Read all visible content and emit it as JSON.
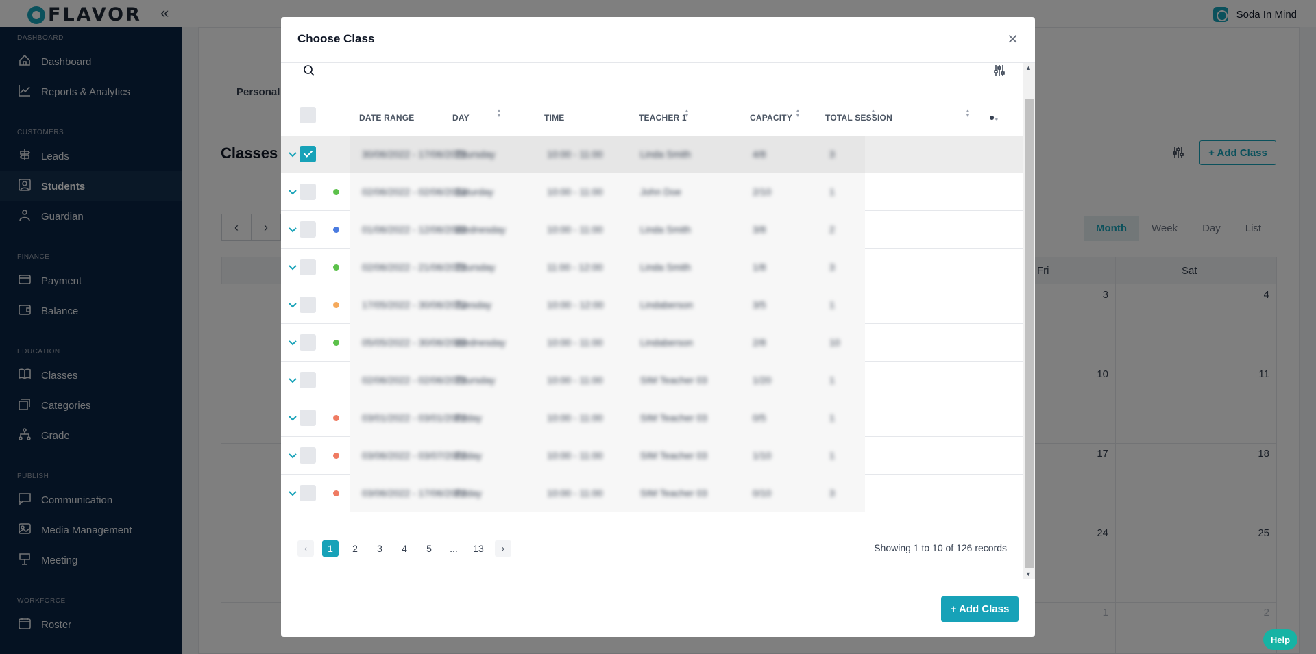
{
  "app": {
    "logo_text": "FLAVOR",
    "org_name": "Soda In Mind"
  },
  "sidebar": {
    "sections": [
      {
        "label": "DASHBOARD",
        "items": [
          {
            "label": "Dashboard",
            "icon": "home-icon"
          },
          {
            "label": "Reports & Analytics",
            "icon": "chart-line-icon"
          }
        ]
      },
      {
        "label": "CUSTOMERS",
        "items": [
          {
            "label": "Leads",
            "icon": "signpost-icon"
          },
          {
            "label": "Students",
            "icon": "student-icon"
          },
          {
            "label": "Guardian",
            "icon": "guardian-icon"
          }
        ]
      },
      {
        "label": "FINANCE",
        "items": [
          {
            "label": "Payment",
            "icon": "card-icon"
          },
          {
            "label": "Balance",
            "icon": "wallet-icon"
          }
        ]
      },
      {
        "label": "EDUCATION",
        "items": [
          {
            "label": "Classes",
            "icon": "book-icon"
          },
          {
            "label": "Categories",
            "icon": "layers-icon"
          },
          {
            "label": "Grade",
            "icon": "hierarchy-icon"
          }
        ]
      },
      {
        "label": "PUBLISH",
        "items": [
          {
            "label": "Communication",
            "icon": "chat-icon"
          },
          {
            "label": "Media Management",
            "icon": "image-icon"
          },
          {
            "label": "Meeting",
            "icon": "podium-icon"
          }
        ]
      },
      {
        "label": "WORKFORCE",
        "items": [
          {
            "label": "Roster",
            "icon": "calendar-icon"
          }
        ]
      }
    ],
    "active": "Students"
  },
  "background": {
    "tab": "Personal",
    "title": "Classes",
    "add_button": "+ Add Class",
    "views": [
      "Month",
      "Week",
      "Day",
      "List"
    ],
    "active_view": "Month",
    "day_headers": [
      "Fri",
      "Sat"
    ],
    "day_numbers": [
      [
        "3",
        "4"
      ],
      [
        "10",
        "11"
      ],
      [
        "17",
        "18"
      ],
      [
        "24",
        "25"
      ],
      [
        "1",
        "2"
      ]
    ]
  },
  "modal": {
    "title": "Choose Class",
    "columns": [
      {
        "label": "DATE RANGE",
        "sortable": true
      },
      {
        "label": "DAY",
        "sortable": false
      },
      {
        "label": "TIME",
        "sortable": true
      },
      {
        "label": "TEACHER 1",
        "sortable": true
      },
      {
        "label": "CAPACITY",
        "sortable": true
      },
      {
        "label": "TOTAL SESSION",
        "sortable": true
      }
    ],
    "rows": [
      {
        "selected": true,
        "dot": "",
        "date_range": "30/06/2022 - 17/06/2022",
        "day": "Thursday",
        "time": "10:00 - 11:00",
        "teacher": "Linda Smith",
        "capacity": "4/8",
        "sessions": "3"
      },
      {
        "selected": false,
        "dot": "#5cc14a",
        "date_range": "02/06/2022 - 02/06/2022",
        "day": "Saturday",
        "time": "10:00 - 11:00",
        "teacher": "John Doe",
        "capacity": "2/10",
        "sessions": "1"
      },
      {
        "selected": false,
        "dot": "#4a7be0",
        "date_range": "01/06/2022 - 12/06/2022",
        "day": "Wednesday",
        "time": "10:00 - 11:00",
        "teacher": "Linda Smith",
        "capacity": "3/8",
        "sessions": "2"
      },
      {
        "selected": false,
        "dot": "#5cc14a",
        "date_range": "02/06/2022 - 21/06/2022",
        "day": "Thursday",
        "time": "11:00 - 12:00",
        "teacher": "Linda Smith",
        "capacity": "1/8",
        "sessions": "3"
      },
      {
        "selected": false,
        "dot": "#f5a95b",
        "date_range": "17/05/2022 - 30/06/2022",
        "day": "Tuesday",
        "time": "10:00 - 12:00",
        "teacher": "Lindaberson",
        "capacity": "3/5",
        "sessions": "1"
      },
      {
        "selected": false,
        "dot": "#5cc14a",
        "date_range": "05/05/2022 - 30/06/2022",
        "day": "Wednesday",
        "time": "10:00 - 11:00",
        "teacher": "Lindaberson",
        "capacity": "2/8",
        "sessions": "10"
      },
      {
        "selected": false,
        "dot": "",
        "date_range": "02/06/2022 - 02/06/2022",
        "day": "Thursday",
        "time": "10:00 - 11:00",
        "teacher": "SIM Teacher 03",
        "capacity": "1/20",
        "sessions": "1"
      },
      {
        "selected": false,
        "dot": "#ef7b62",
        "date_range": "03/01/2022 - 03/01/2022",
        "day": "Friday",
        "time": "10:00 - 11:00",
        "teacher": "SIM Teacher 03",
        "capacity": "0/5",
        "sessions": "1"
      },
      {
        "selected": false,
        "dot": "#ef7b62",
        "date_range": "03/06/2022 - 03/07/2022",
        "day": "Friday",
        "time": "10:00 - 11:00",
        "teacher": "SIM Teacher 03",
        "capacity": "1/10",
        "sessions": "1"
      },
      {
        "selected": false,
        "dot": "#ef7b62",
        "date_range": "03/06/2022 - 17/06/2022",
        "day": "Friday",
        "time": "10:00 - 11:00",
        "teacher": "SIM Teacher 03",
        "capacity": "0/10",
        "sessions": "3"
      }
    ],
    "pagination": {
      "pages": [
        "1",
        "2",
        "3",
        "4",
        "5",
        "...",
        "13"
      ],
      "current": "1"
    },
    "records_text": "Showing 1 to 10 of 126 records",
    "add_button": "+ Add Class"
  },
  "help_label": "Help",
  "accent_color": "#17a2b8",
  "sidebar_color": "#0b2545"
}
